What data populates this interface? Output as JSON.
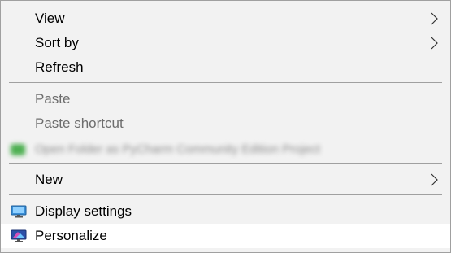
{
  "menu": {
    "items": [
      {
        "label": "View",
        "has_submenu": true
      },
      {
        "label": "Sort by",
        "has_submenu": true
      },
      {
        "label": "Refresh"
      },
      {
        "label": "Paste",
        "disabled": true
      },
      {
        "label": "Paste shortcut",
        "disabled": true
      },
      {
        "label": "Open Folder as PyCharm Community Edition Project",
        "blurred": true
      },
      {
        "label": "New",
        "has_submenu": true
      },
      {
        "label": "Display settings",
        "icon": "monitor-icon"
      },
      {
        "label": "Personalize",
        "icon": "personalize-icon",
        "highlighted": true
      }
    ]
  },
  "colors": {
    "menu_background": "#f2f2f2",
    "highlight_background": "#ffffff",
    "separator": "#a0a0a0",
    "disabled_text": "#6d6d6d"
  }
}
